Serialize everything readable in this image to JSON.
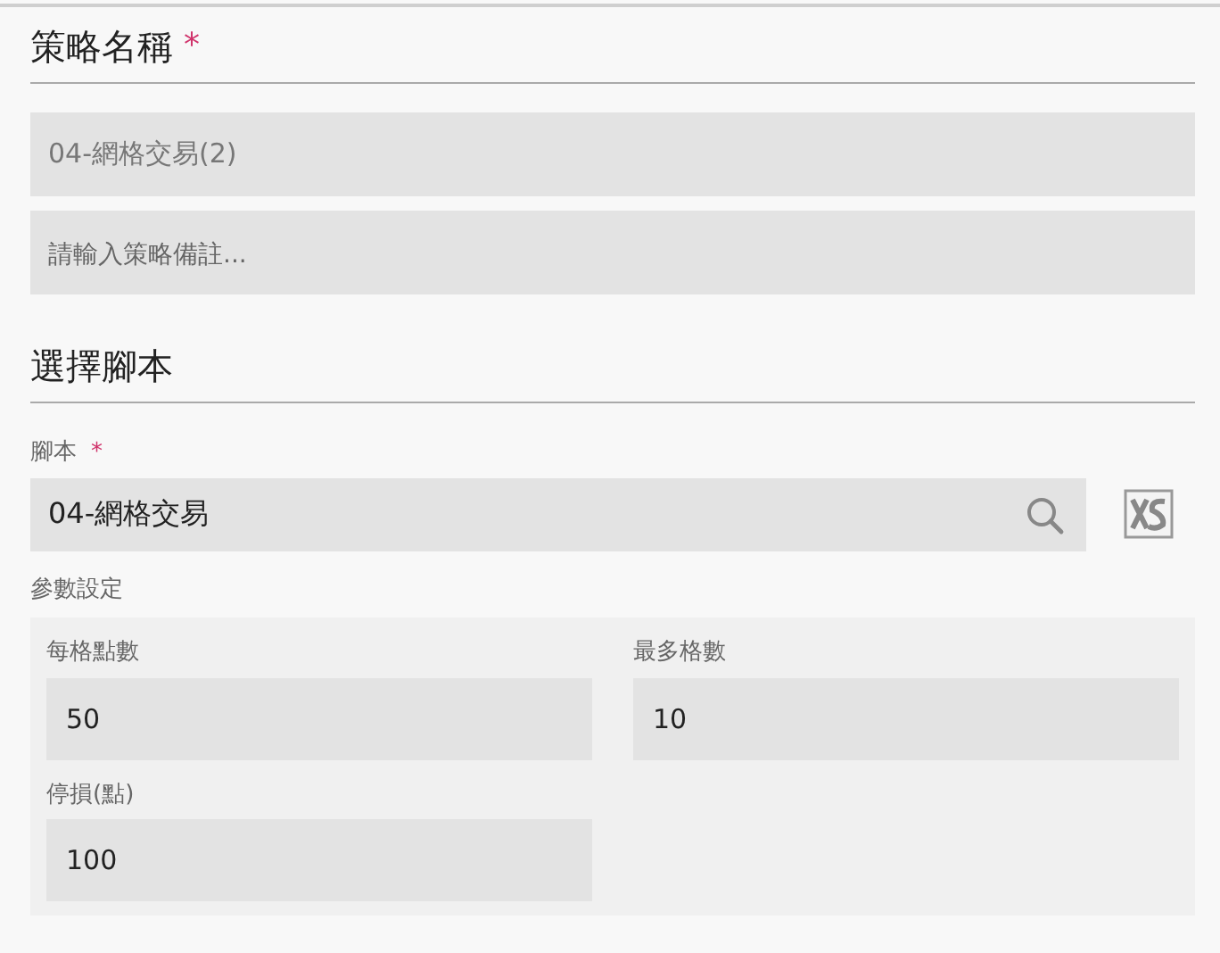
{
  "strategy_name": {
    "heading": "策略名稱",
    "required_mark": "*",
    "name_value": "04-網格交易(2)",
    "note_placeholder": "請輸入策略備註..."
  },
  "script_section": {
    "heading": "選擇腳本",
    "script_label": "腳本",
    "required_mark": "*",
    "script_value": "04-網格交易"
  },
  "parameters": {
    "label": "參數設定",
    "fields": [
      {
        "label": "每格點數",
        "value": "50"
      },
      {
        "label": "最多格數",
        "value": "10"
      },
      {
        "label": "停損(點)",
        "value": "100"
      }
    ]
  }
}
